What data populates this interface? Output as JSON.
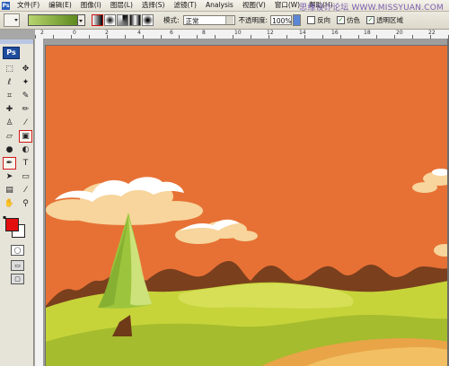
{
  "menu": {
    "items": [
      "文件(F)",
      "编辑(E)",
      "图像(I)",
      "图层(L)",
      "选择(S)",
      "滤镜(T)",
      "Analysis",
      "视图(V)",
      "窗口(W)",
      "帮助(H)"
    ]
  },
  "watermark": "思缘设计论坛 WWW.MISSYUAN.COM",
  "options": {
    "mode_label": "模式:",
    "mode_value": "正常",
    "opacity_label": "不透明度:",
    "opacity_value": "100%",
    "checkboxes": [
      {
        "label": "反向",
        "checked": false
      },
      {
        "label": "仿色",
        "checked": true
      },
      {
        "label": "透明区域",
        "checked": true
      }
    ],
    "gradient_colors": [
      "#b7d56d",
      "#5d8a1e"
    ]
  },
  "ruler": {
    "numbers": [
      "2",
      "0",
      "2",
      "4",
      "6",
      "8",
      "10",
      "12",
      "14",
      "16",
      "18",
      "20",
      "22"
    ]
  },
  "toolbox": {
    "logo": "Ps",
    "tools": [
      {
        "icon": "marquee-icon",
        "glyph": "⬚"
      },
      {
        "icon": "move-icon",
        "glyph": "✥"
      },
      {
        "icon": "lasso-icon",
        "glyph": "ℓ"
      },
      {
        "icon": "magic-wand-icon",
        "glyph": "✦"
      },
      {
        "icon": "crop-icon",
        "glyph": "⌗"
      },
      {
        "icon": "slice-icon",
        "glyph": "✎"
      },
      {
        "icon": "healing-icon",
        "glyph": "✚"
      },
      {
        "icon": "brush-icon",
        "glyph": "✏"
      },
      {
        "icon": "stamp-icon",
        "glyph": "♙"
      },
      {
        "icon": "history-brush-icon",
        "glyph": "⁄"
      },
      {
        "icon": "eraser-icon",
        "glyph": "▱"
      },
      {
        "icon": "gradient-icon",
        "glyph": "▣",
        "selected": true
      },
      {
        "icon": "blur-icon",
        "glyph": "●"
      },
      {
        "icon": "dodge-icon",
        "glyph": "◐"
      },
      {
        "icon": "pen-icon",
        "glyph": "✒",
        "selected": true
      },
      {
        "icon": "type-icon",
        "glyph": "T"
      },
      {
        "icon": "path-select-icon",
        "glyph": "➤"
      },
      {
        "icon": "shape-icon",
        "glyph": "▭"
      },
      {
        "icon": "notes-icon",
        "glyph": "▤"
      },
      {
        "icon": "eyedropper-icon",
        "glyph": "⁄"
      },
      {
        "icon": "hand-icon",
        "glyph": "✋"
      },
      {
        "icon": "zoom-icon",
        "glyph": "⚲"
      }
    ],
    "foreground_color": "#e30f0f",
    "background_color": "#ffffff"
  },
  "canvas": {
    "background": "#e77135"
  }
}
